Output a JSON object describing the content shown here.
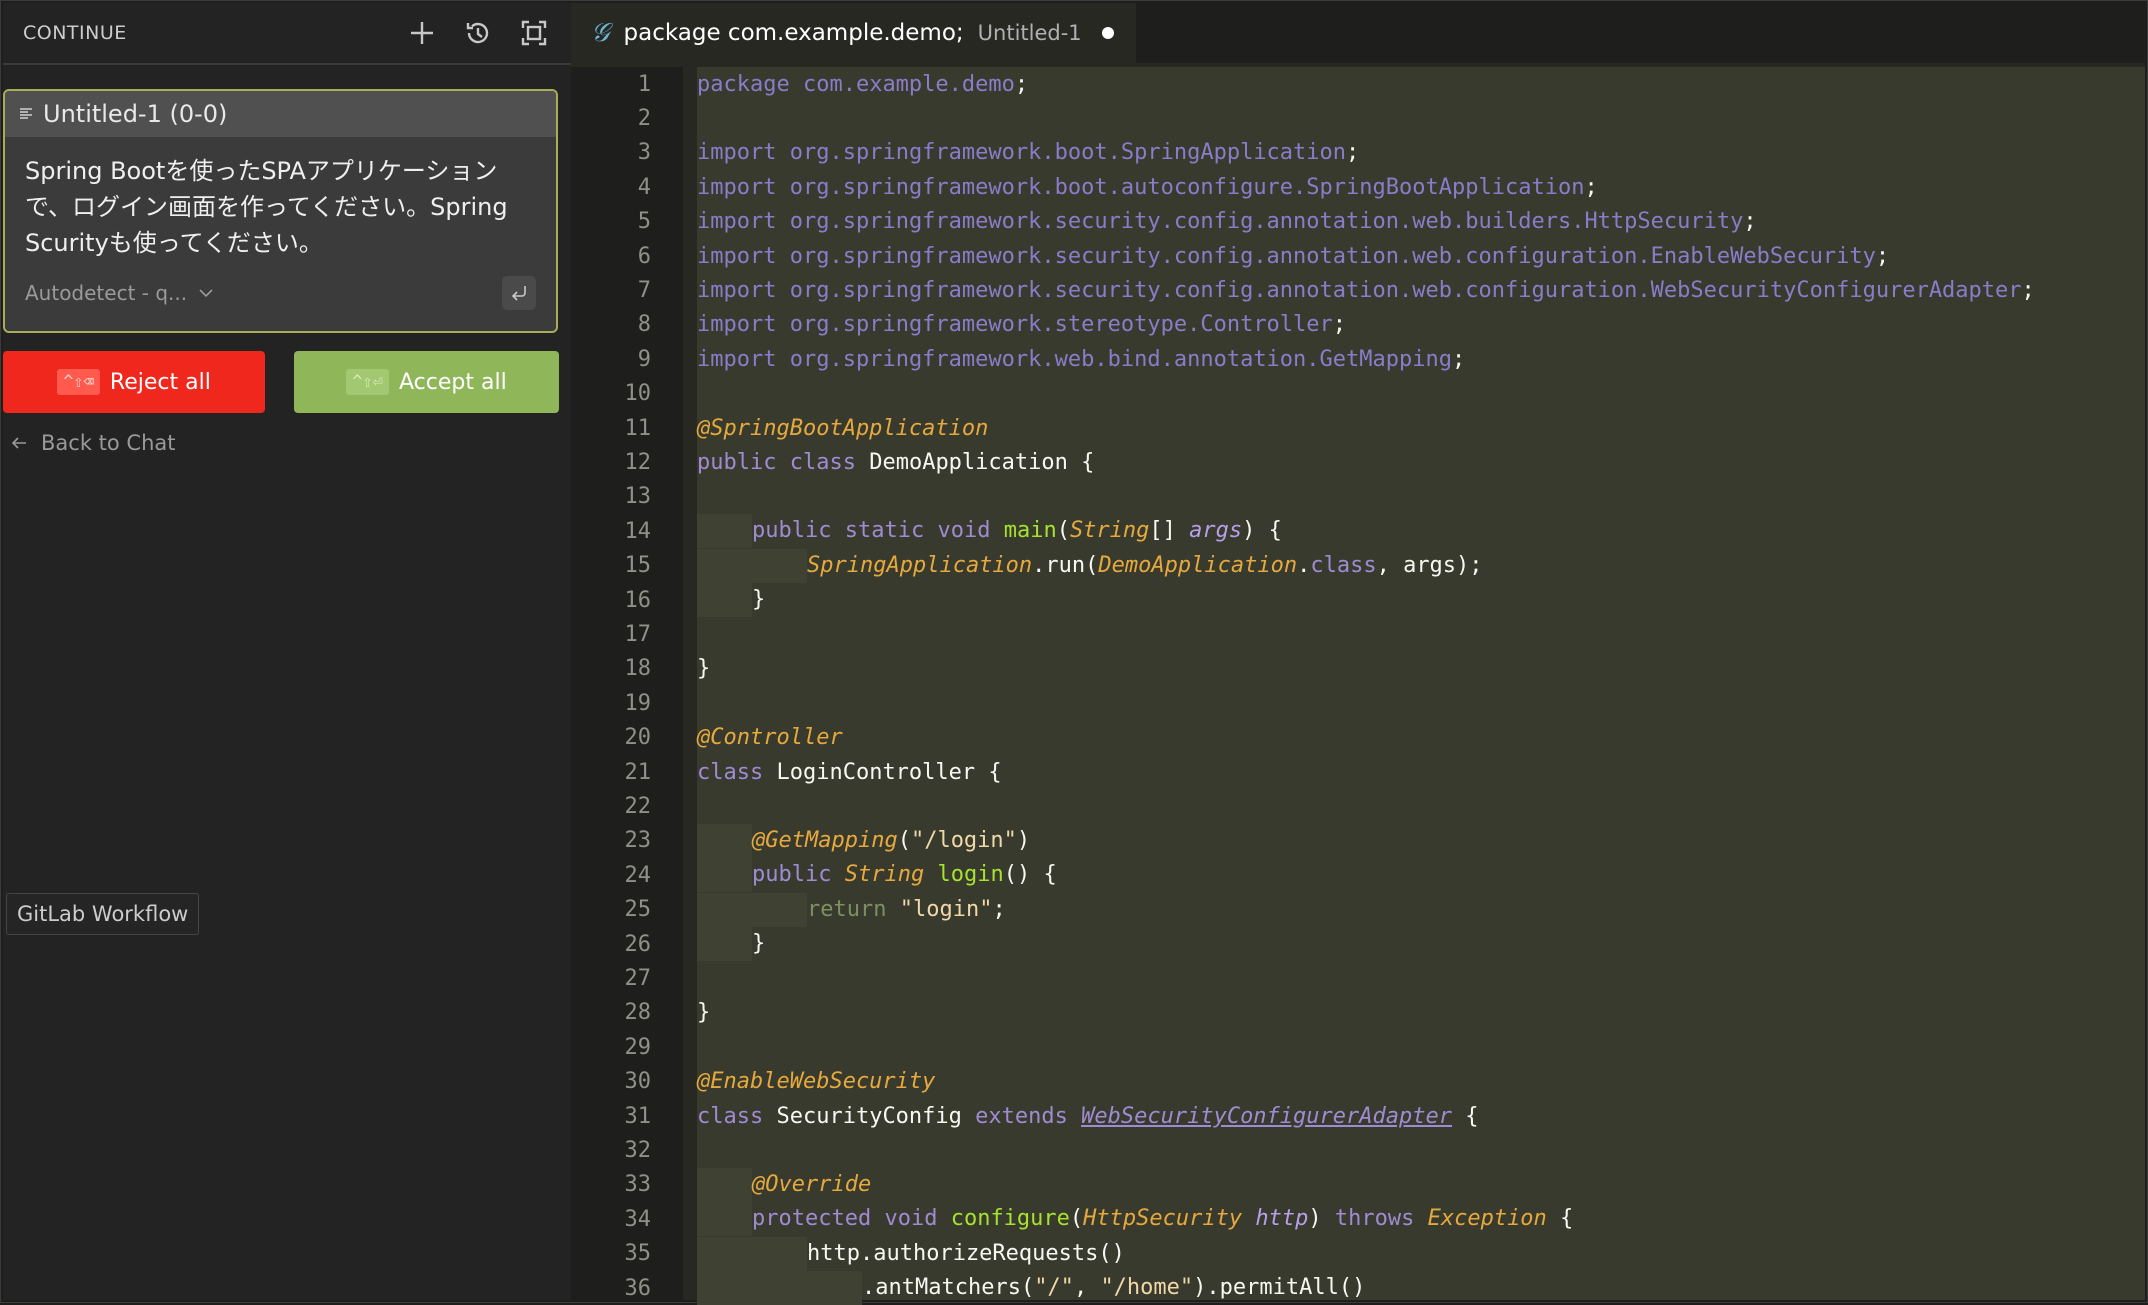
{
  "sidebar": {
    "title": "CONTINUE",
    "icons": [
      "plus-icon",
      "history-icon",
      "fullscreen-icon"
    ],
    "card": {
      "title": "Untitled-1 (0-0)",
      "message_line1": "Spring Bootを使ったSPAアプリケーション",
      "message_line2": "で、ログイン画面を作ってください。Spring",
      "message_line3": "Scurityも使ってください。",
      "model": "Autodetect - q..."
    },
    "reject_shortcut": "^⇧⌫",
    "reject_label": "Reject all",
    "accept_shortcut": "^⇧⏎",
    "accept_label": "Accept all",
    "back_label": "Back to Chat",
    "tooltip": "GitLab Workflow"
  },
  "editor": {
    "tab_title": "package com.example.demo;",
    "tab_desc": "Untitled-1",
    "lines": [
      "package com.example.demo;",
      "",
      "import org.springframework.boot.SpringApplication;",
      "import org.springframework.boot.autoconfigure.SpringBootApplication;",
      "import org.springframework.security.config.annotation.web.builders.HttpSecurity;",
      "import org.springframework.security.config.annotation.web.configuration.EnableWebSecurity;",
      "import org.springframework.security.config.annotation.web.configuration.WebSecurityConfigurerAdapter;",
      "import org.springframework.stereotype.Controller;",
      "import org.springframework.web.bind.annotation.GetMapping;",
      "",
      "@SpringBootApplication",
      "public class DemoApplication {",
      "",
      "    public static void main(String[] args) {",
      "        SpringApplication.run(DemoApplication.class, args);",
      "    }",
      "",
      "}",
      "",
      "@Controller",
      "class LoginController {",
      "",
      "    @GetMapping(\"/login\")",
      "    public String login() {",
      "        return \"login\";",
      "    }",
      "",
      "}",
      "",
      "@EnableWebSecurity",
      "class SecurityConfig extends WebSecurityConfigurerAdapter {",
      "",
      "    @Override",
      "    protected void configure(HttpSecurity http) throws Exception {",
      "        http.authorizeRequests()",
      "            .antMatchers(\"/\", \"/home\").permitAll()"
    ]
  }
}
